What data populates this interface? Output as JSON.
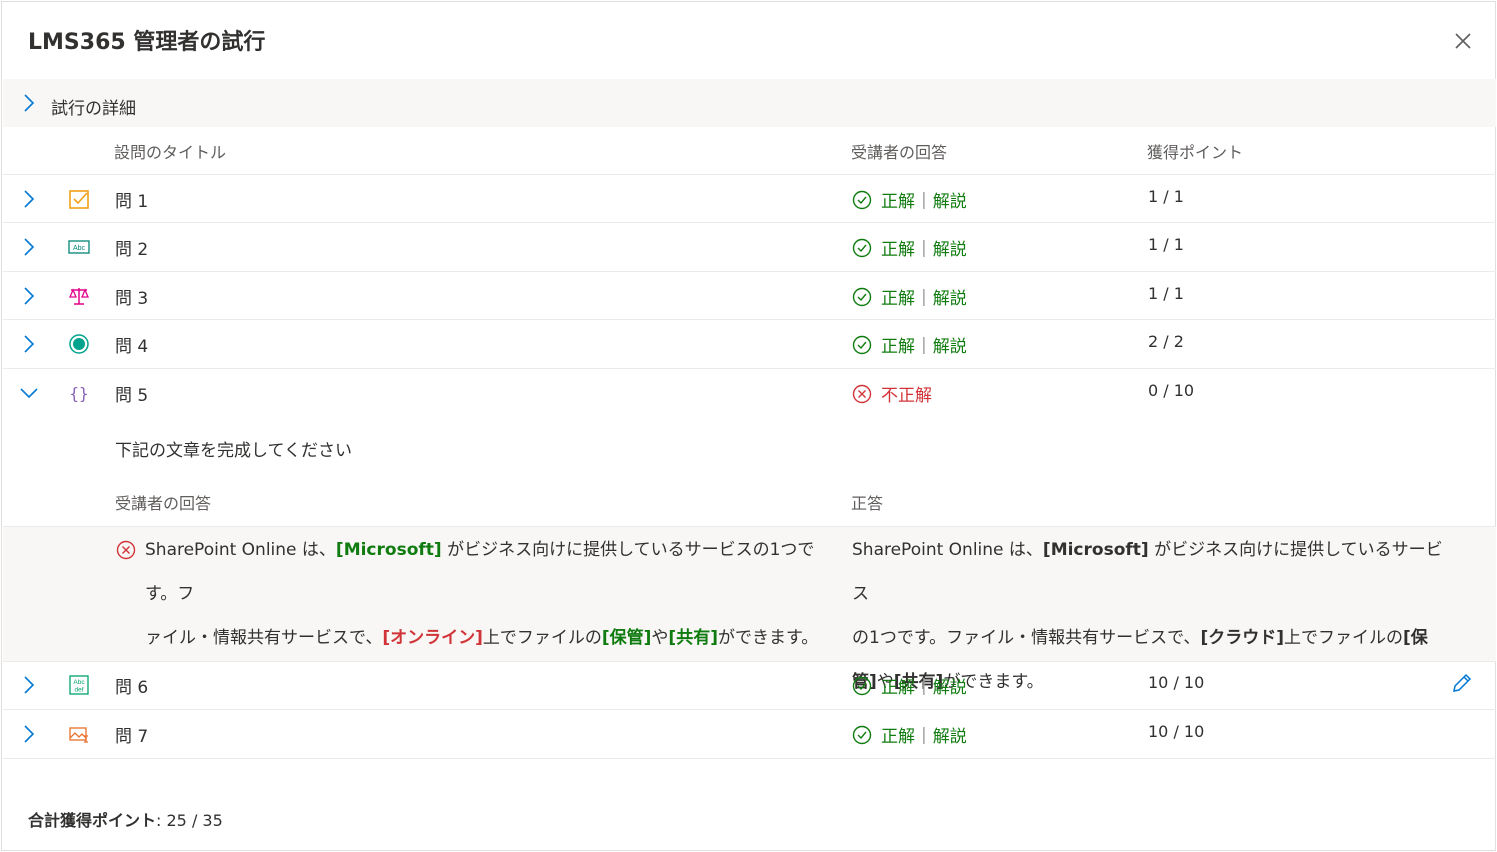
{
  "dialog": {
    "title": "LMS365 管理者の試行",
    "details_label": "試行の詳細"
  },
  "columns": {
    "question_title": "設問のタイトル",
    "learner_answer": "受講者の回答",
    "points": "獲得ポイント"
  },
  "labels": {
    "correct": "正解",
    "separator": "|",
    "explanation": "解説",
    "incorrect": "不正解"
  },
  "questions": [
    {
      "title": "問 1",
      "icon": "checkbox-question-icon",
      "result": "correct",
      "points": "1 / 1"
    },
    {
      "title": "問 2",
      "icon": "text-entry-question-icon",
      "result": "correct",
      "points": "1 / 1"
    },
    {
      "title": "問 3",
      "icon": "balance-scale-icon",
      "result": "correct",
      "points": "1 / 1"
    },
    {
      "title": "問 4",
      "icon": "radio-question-icon",
      "result": "correct",
      "points": "2 / 2"
    },
    {
      "title": "問 5",
      "icon": "curly-braces-icon",
      "result": "incorrect",
      "points": "0 / 10"
    },
    {
      "title": "問 6",
      "icon": "abc-def-question-icon",
      "result": "correct",
      "points": "10 / 10"
    },
    {
      "title": "問 7",
      "icon": "image-question-icon",
      "result": "correct",
      "points": "10 / 10"
    }
  ],
  "expanded": {
    "instruction": "下記の文章を完成してください",
    "learner_answer_header": "受講者の回答",
    "correct_answer_header": "正答",
    "learner_answer": {
      "p1": "SharePoint Online は、",
      "k1": "[Microsoft]",
      "p2": " がビジネス向けに提供しているサービスの1つです。フ",
      "p3": "ァイル・情報共有サービスで、",
      "k2": "[オンライン]",
      "p4": "上でファイルの",
      "k3": "[保管]",
      "p5": "や",
      "k4": "[共有]",
      "p6": "ができます。"
    },
    "correct_answer": {
      "p1": "SharePoint Online は、",
      "k1": "[Microsoft]",
      "p2": " がビジネス向けに提供しているサービス",
      "p3": "の1つです。ファイル・情報共有サービスで、",
      "k2": "[クラウド]",
      "p4": "上でファイルの",
      "k3a": "[保",
      "k3b": "管]",
      "p5": "や",
      "k4": "[共有]",
      "p6": "ができます。"
    }
  },
  "footer": {
    "total_label": "合計獲得ポイント",
    "total_value": ": 25 / 35"
  },
  "colors": {
    "correct": "#107c10",
    "incorrect": "#d13438",
    "chevron": "#0078d4"
  }
}
